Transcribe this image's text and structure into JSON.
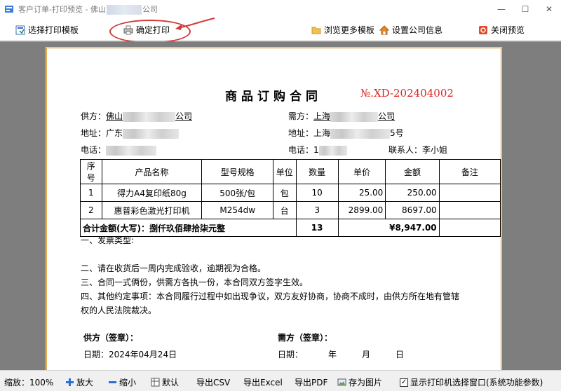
{
  "window": {
    "title_prefix": "客户订单-打印预览 - 佛山",
    "title_suffix": "公司",
    "minimize": "—",
    "maximize": "☐",
    "close": "✕"
  },
  "toolbar": {
    "select_template": "选择打印模板",
    "confirm_print": "确定打印",
    "browse_templates": "浏览更多模板",
    "company_info": "设置公司信息",
    "close_preview": "关闭预览"
  },
  "document": {
    "title": "商品订购合同",
    "number": "№.XD-202404002",
    "supplier_label": "供方：",
    "supplier_name_a": "佛山",
    "supplier_name_b": "公司",
    "buyer_label": "需方：",
    "buyer_name_a": "上海",
    "buyer_name_b": "公司",
    "supplier_address_label": "地址：",
    "supplier_address": "广东",
    "buyer_address_label": "地址：",
    "buyer_address_a": "上海",
    "buyer_address_b": "5号",
    "supplier_phone_label": "电话：",
    "supplier_phone": "",
    "buyer_phone_label": "电话：",
    "buyer_phone": "1",
    "contact_label": "联系人：",
    "contact_name": "李小姐",
    "table": {
      "headers": [
        "序号",
        "产品名称",
        "型号规格",
        "单位",
        "数量",
        "单价",
        "金额",
        "备注"
      ],
      "rows": [
        [
          "1",
          "得力A4复印纸80g",
          "500张/包",
          "包",
          "10",
          "25.00",
          "250.00",
          ""
        ],
        [
          "2",
          "惠普彩色激光打印机",
          "M254dw",
          "台",
          "3",
          "2899.00",
          "8697.00",
          ""
        ]
      ],
      "total_label": "合计金额(大写)：捌仟玖佰肆拾柒元整",
      "total_qty": "13",
      "total_amount": "¥8,947.00"
    },
    "clauses": [
      "一、发票类型:",
      "二、请在收货后一周内完成验收，逾期视为合格。",
      "三、合同一式俩份，供需方各执一份，本合同双方签字生效。",
      "四、其他约定事项：本合同履行过程中如出现争议，双方友好协商，协商不成时，由供方所在地有管辖",
      "权的人民法院裁决。"
    ],
    "supplier_sign": "供方（签章）：",
    "buyer_sign": "需方（签章）：",
    "supplier_date": "日期：2024年04月24日",
    "buyer_date_label": "日期：",
    "buyer_date_year": "年",
    "buyer_date_month": "月",
    "buyer_date_day": "日"
  },
  "statusbar": {
    "zoom_label": "缩放：",
    "zoom_value": "100%",
    "zoom_in": "放大",
    "zoom_out": "缩小",
    "default": "默认",
    "export_csv": "导出CSV",
    "export_excel": "导出Excel",
    "export_pdf": "导出PDF",
    "save_image": "存为图片",
    "show_printer_dialog": "显示打印机选择窗口(系统功能参数)"
  },
  "colors": {
    "accent_red": "#d23a3a",
    "doc_number": "#dd2222",
    "paper_border": "#d9a23a",
    "workarea_bg": "#7e7e7e"
  }
}
